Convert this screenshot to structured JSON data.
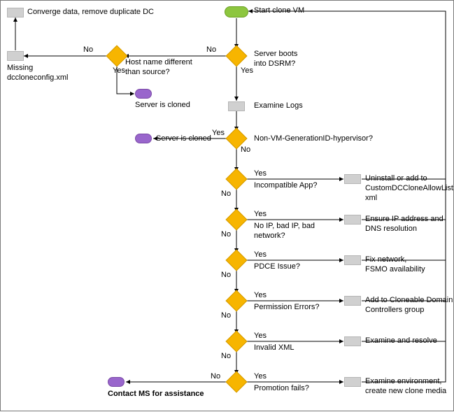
{
  "start": "Start clone VM",
  "dsrm": "Server boots\ninto DSRM?",
  "hostname": "Host name different\nthan source?",
  "missing": "Missing\ndccloneconfig.xml",
  "converge": "Converge data, remove duplicate DC",
  "cloned1": "Server is cloned",
  "cloned2": "Server is cloned",
  "examine_logs": "Examine Logs",
  "nonvm": "Non-VM-GenerationID-hypervisor?",
  "incompat": "Incompatible App?",
  "incompat_fix": "Uninstall or add to\nCustomDCCloneAllowList.\nxml",
  "badip": "No IP, bad IP, bad\nnetwork?",
  "badip_fix": "Ensure IP address and\nDNS resolution",
  "pdce": "PDCE Issue?",
  "pdce_fix": "Fix network,\nFSMO availability",
  "perm": "Permission Errors?",
  "perm_fix": "Add to Cloneable Domain\nControllers group",
  "xml": "Invalid XML",
  "xml_fix": "Examine and resolve",
  "promo": "Promotion fails?",
  "promo_fix": "Examine environment,\ncreate new clone media",
  "contact": "Contact MS for assistance",
  "yes": "Yes",
  "no": "No"
}
